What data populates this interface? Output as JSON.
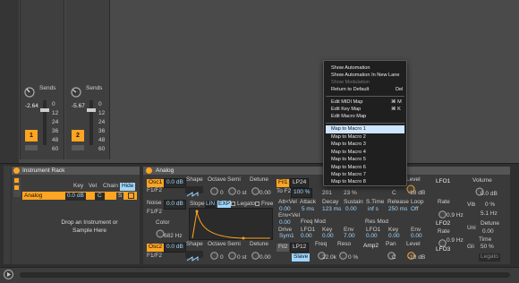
{
  "mixer": {
    "channels": [
      {
        "sends_label": "Sends",
        "sends_value": "-2.64",
        "track_number": "1"
      },
      {
        "sends_label": "Sends",
        "sends_value": "-5.67",
        "track_number": "2"
      }
    ],
    "meter_scale": [
      "0",
      "12",
      "24",
      "36",
      "48",
      "60"
    ]
  },
  "context_menu": {
    "items": [
      {
        "label": "Show Automation",
        "shortcut": "",
        "disabled": false
      },
      {
        "label": "Show Automation In New Lane",
        "shortcut": "",
        "disabled": false
      },
      {
        "label": "Show Modulation",
        "shortcut": "",
        "disabled": true
      },
      {
        "label": "Return to Default",
        "shortcut": "Del",
        "disabled": false
      },
      {
        "label": "Edit MIDI Map",
        "shortcut": "⌘ M",
        "disabled": false
      },
      {
        "label": "Edit Key Map",
        "shortcut": "⌘ K",
        "disabled": false
      },
      {
        "label": "Edit Macro Map",
        "shortcut": "",
        "disabled": false
      },
      {
        "label": "Map to Macro 1",
        "shortcut": "",
        "disabled": false
      },
      {
        "label": "Map to Macro 2",
        "shortcut": "",
        "disabled": false
      },
      {
        "label": "Map to Macro 3",
        "shortcut": "",
        "disabled": false
      },
      {
        "label": "Map to Macro 4",
        "shortcut": "",
        "disabled": false
      },
      {
        "label": "Map to Macro 5",
        "shortcut": "",
        "disabled": false
      },
      {
        "label": "Map to Macro 6",
        "shortcut": "",
        "disabled": false
      },
      {
        "label": "Map to Macro 7",
        "shortcut": "",
        "disabled": false
      },
      {
        "label": "Map to Macro 8",
        "shortcut": "",
        "disabled": false
      }
    ],
    "highlighted_item": "Map to Macro 1"
  },
  "instrument_rack": {
    "title": "Instrument Rack",
    "toolbar": {
      "key": "Key",
      "vel": "Vel",
      "chain": "Chain",
      "hide": "Hide"
    },
    "chain_name": "Analog",
    "chain_volume": "0.0 dB",
    "chain_pan": "C",
    "chain_s": "S",
    "drop_text": "Drop an Instrument or Sample Here"
  },
  "analog": {
    "title": "Analog",
    "osc1": {
      "label": "Osc1",
      "level": "0.0 dB",
      "f1f2": "F1/F2",
      "shape_label": "Shape",
      "octave_label": "Octave",
      "octave_value": "0",
      "semi_label": "Semi",
      "semi_value": "0 st",
      "detune_label": "Detune",
      "detune_value": "0.00"
    },
    "noise": {
      "label": "Noise",
      "level": "0.0 dB",
      "f1f2": "F1/F2",
      "color_label": "Color",
      "color_value": "682 Hz"
    },
    "osc2": {
      "label": "Osc2",
      "level": "0.0 dB",
      "f1f2": "F1/F2",
      "shape_label": "Shape",
      "octave_label": "Octave",
      "octave_value": "0",
      "semi_label": "Semi",
      "semi_value": "0 st",
      "detune_label": "Detune",
      "detune_value": "0.00"
    },
    "filter1": {
      "label": "Fil1",
      "type": "LP24",
      "to_f2_label": "To F2",
      "to_f2_value": "100 %",
      "freq_value": "201",
      "reso_value": "23 %"
    },
    "filter2": {
      "label": "Fil2",
      "type": "LP12",
      "slave": "Slave",
      "freq_label": "Freq",
      "freq_value": "22.0k",
      "reso_label": "Reso",
      "reso_value": "0 %"
    },
    "amp1": {
      "label": "Amp1",
      "pan_value": "C",
      "level_label": "Level",
      "level_value": "-18 dB"
    },
    "amp2": {
      "label": "Amp2",
      "pan_label": "Pan",
      "pan_value": "C",
      "level_label": "Level",
      "level_value": "-18 dB"
    },
    "envelope": {
      "slope_label": "Slope",
      "lin": "LIN",
      "exp": "EXP",
      "legato": "Legato",
      "free": "Free",
      "att_vel_label": "Att<Vel",
      "att_vel_value": "0.00",
      "attack_label": "Attack",
      "attack_value": "5 ms",
      "decay_label": "Decay",
      "decay_value": "123 ms",
      "sustain_label": "Sustain",
      "sustain_value": "0.00",
      "stime_label": "S.Time",
      "stime_value": "inf s",
      "release_label": "Release",
      "release_value": "250 ms",
      "loop_label": "Loop",
      "loop_value": "Off",
      "env_vel_label": "Env<Vel",
      "env_vel_value": "0.00",
      "freq_mod_label": "Freq Mod",
      "res_mod_label": "Res Mod",
      "drive_label": "Drive",
      "drive_value": "Sym1",
      "lfo1_label": "LFO1",
      "lfo1_value": "0.00",
      "key_label": "Key",
      "key_value": "0.00",
      "env_label": "Env",
      "env_value": "7.00",
      "lfo1b_label": "LFO1",
      "lfo1b_value": "0.00",
      "keyb_label": "Key",
      "keyb_value": "0.00",
      "envb_label": "Env",
      "envb_value": "0.00"
    },
    "lfo": {
      "lfo1_label": "LFO1",
      "rate1_label": "Rate",
      "rate1_value": "0.9 Hz",
      "lfo2_label": "LFO2",
      "rate2_label": "Rate",
      "rate2_value": "0.9 Hz",
      "lfo3_label": "LFO3"
    },
    "global": {
      "volume_label": "Volume",
      "volume_value": "0.0 dB",
      "vib_label": "Vib",
      "vib_value": "0 %",
      "rate_value": "5.1 Hz",
      "uni_label": "Uni",
      "detune_label": "Detune",
      "detune_value": "0.00",
      "time_label": "Time",
      "gli_label": "Gli",
      "gli_value": "50 %",
      "legato_label": "Legato"
    }
  },
  "colors": {
    "accent": "#ffa521",
    "menu_bg": "#1f1f1f",
    "menu_highlight": "#cfe4ff",
    "value_blue": "#9fd6ff",
    "panel_bg": "#3a3a3a"
  },
  "icons": [
    "play-triangle-icon",
    "device-power-icon",
    "fold-arrow-icon"
  ]
}
